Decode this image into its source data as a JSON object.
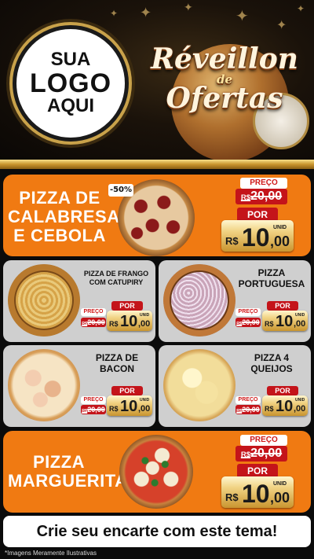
{
  "header": {
    "logo_line1": "SUA",
    "logo_line2": "LOGO",
    "logo_line3": "AQUI",
    "title_line1": "Réveillon",
    "title_de": "de",
    "title_line2": "Ofertas"
  },
  "labels": {
    "preco": "PREÇO",
    "por": "POR",
    "currency": "R$",
    "unid": "UNID"
  },
  "products": [
    {
      "name_line1": "PIZZA DE",
      "name_line2": "CALABRESA",
      "name_line3": "E CEBOLA",
      "discount": "-50%",
      "old_price": "20,00",
      "price_int": "10",
      "price_dec": ",00"
    },
    {
      "name_line1": "PIZZA DE FRANGO",
      "name_line2": "COM CATUPIRY",
      "old_price": "20,00",
      "price_int": "10",
      "price_dec": ",00"
    },
    {
      "name_line1": "PIZZA",
      "name_line2": "PORTUGUESA",
      "old_price": "20,00",
      "price_int": "10",
      "price_dec": ",00"
    },
    {
      "name_line1": "PIZZA DE",
      "name_line2": "BACON",
      "old_price": "20,00",
      "price_int": "10",
      "price_dec": ",00"
    },
    {
      "name_line1": "PIZZA 4",
      "name_line2": "QUEIJOS",
      "old_price": "20,00",
      "price_int": "10",
      "price_dec": ",00"
    },
    {
      "name_line1": "PIZZA",
      "name_line2": "MARGUERITA",
      "old_price": "20,00",
      "price_int": "10",
      "price_dec": ",00"
    }
  ],
  "footer": {
    "cta": "Crie seu encarte com este tema!",
    "disclaimer": "*Imagens Meramente Ilustrativas"
  },
  "colors": {
    "orange": "#f07a12",
    "gray_card": "#cfcfcf",
    "red": "#c4141a",
    "gold": "#d9b04a"
  }
}
